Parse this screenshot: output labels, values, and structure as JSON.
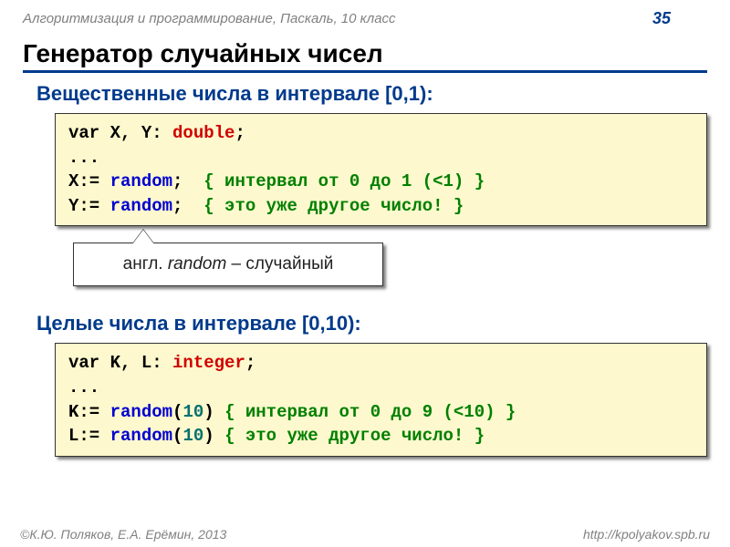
{
  "header": {
    "course": "Алгоритмизация и программирование, Паскаль, 10 класс",
    "page": "35"
  },
  "title": "Генератор случайных чисел",
  "section1": {
    "heading": "Вещественные числа в интервале [0,1):",
    "code": {
      "l1a": "var X, Y: ",
      "l1b": "double",
      "l1c": ";",
      "l2": "...",
      "l3a": "X:= ",
      "l3b": "random",
      "l3c": ";  ",
      "l3d": "{ интервал от 0 до 1 (<1) }",
      "l4a": "Y:= ",
      "l4b": "random",
      "l4c": ";  ",
      "l4d": "{ это уже другое число! }"
    }
  },
  "note": {
    "prefix": "англ. ",
    "word": "random",
    "suffix": " – случайный"
  },
  "section2": {
    "heading": "Целые числа в интервале [0,10):",
    "code": {
      "l1a": "var K, L: ",
      "l1b": "integer",
      "l1c": ";",
      "l2": "...",
      "l3a": "K:= ",
      "l3b": "random",
      "l3c": "(",
      "l3d": "10",
      "l3e": ") ",
      "l3f": "{ интервал от 0 до 9 (<10) }",
      "l4a": "L:= ",
      "l4b": "random",
      "l4c": "(",
      "l4d": "10",
      "l4e": ") ",
      "l4f": "{ это уже другое число! }"
    }
  },
  "footer": {
    "authors": "©К.Ю. Поляков, Е.А. Ерёмин, 2013",
    "url": "http://kpolyakov.spb.ru"
  }
}
